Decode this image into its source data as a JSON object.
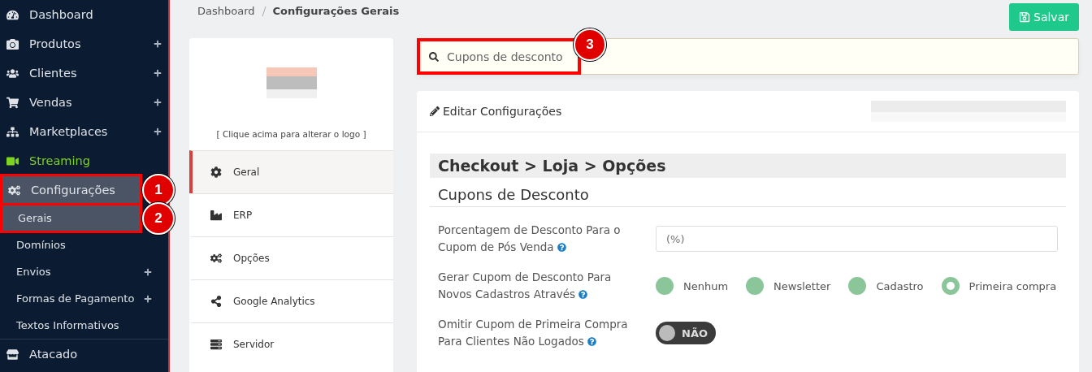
{
  "sidebar": {
    "items": [
      {
        "label": "Dashboard",
        "kind": "main",
        "expandable": false,
        "selected": false
      },
      {
        "label": "Produtos",
        "kind": "main",
        "expandable": true,
        "selected": false
      },
      {
        "label": "Clientes",
        "kind": "main",
        "expandable": true,
        "selected": false
      },
      {
        "label": "Vendas",
        "kind": "main",
        "expandable": true,
        "selected": false
      },
      {
        "label": "Marketplaces",
        "kind": "main",
        "expandable": true,
        "selected": false
      },
      {
        "label": "Streaming",
        "kind": "main",
        "expandable": false,
        "selected": false,
        "color": "#7ed321"
      },
      {
        "label": "Configurações",
        "kind": "main",
        "expandable": false,
        "selected": true,
        "marker": "1"
      },
      {
        "label": "Gerais",
        "kind": "sub",
        "expandable": false,
        "selected": true,
        "marker": "2"
      },
      {
        "label": "Domínios",
        "kind": "sub",
        "expandable": false,
        "selected": false
      },
      {
        "label": "Envios",
        "kind": "sub",
        "expandable": true,
        "selected": false
      },
      {
        "label": "Formas de Pagamento",
        "kind": "sub",
        "expandable": true,
        "selected": false
      },
      {
        "label": "Textos Informativos",
        "kind": "sub",
        "expandable": false,
        "selected": false
      },
      {
        "label": "Atacado",
        "kind": "main",
        "expandable": false,
        "selected": false
      }
    ]
  },
  "breadcrumb": [
    "Dashboard",
    "Configurações Gerais"
  ],
  "save_button": "Salvar",
  "settings_menu": {
    "logo_hint": "[ Clique acima para alterar o logo ]",
    "items": [
      {
        "label": "Geral",
        "selected": true
      },
      {
        "label": "ERP",
        "selected": false
      },
      {
        "label": "Opções",
        "selected": false
      },
      {
        "label": "Google Analytics",
        "selected": false
      },
      {
        "label": "Servidor",
        "selected": false
      }
    ]
  },
  "search": {
    "value": "Cupons de desconto",
    "marker": "3"
  },
  "editor": {
    "title": "Editar Configurações",
    "path": "Checkout > Loja > Opções",
    "section": "Cupons de Desconto",
    "fields": [
      {
        "kind": "text",
        "label": "Porcentagem de Desconto Para o Cupom de Pós Venda",
        "placeholder": "(%)"
      },
      {
        "kind": "radio",
        "label": "Gerar Cupom de Desconto Para Novos Cadastros Através",
        "options": [
          {
            "label": "Nenhum",
            "selected": false
          },
          {
            "label": "Newsletter",
            "selected": false
          },
          {
            "label": "Cadastro",
            "selected": false
          },
          {
            "label": "Primeira compra",
            "selected": true
          }
        ]
      },
      {
        "kind": "toggle",
        "label": "Omitir Cupom de Primeira Compra Para Clientes Não Logados",
        "on": false,
        "state_text": "NÃO"
      }
    ]
  }
}
